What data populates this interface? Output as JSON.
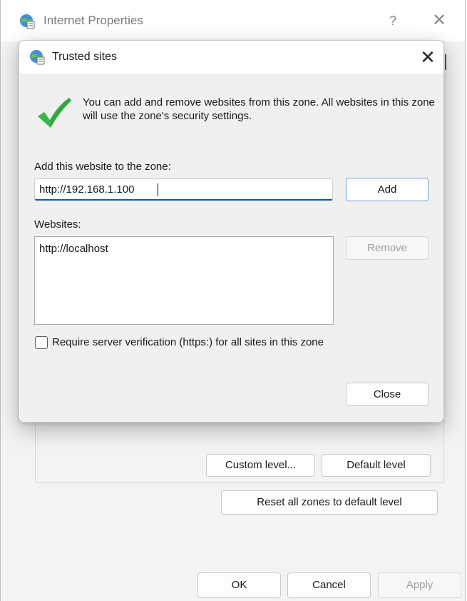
{
  "parent": {
    "title": "Internet Properties",
    "help_label": "?",
    "close_label": "✕",
    "custom_level_label": "Custom level...",
    "default_level_label": "Default level",
    "reset_all_label": "Reset all zones to default level",
    "ok_label": "OK",
    "cancel_label": "Cancel",
    "apply_label": "Apply"
  },
  "dialog": {
    "title": "Trusted sites",
    "close_label": "✕",
    "description": "You can add and remove websites from this zone. All websites in this zone will use the zone's security settings.",
    "add_website_label": "Add this website to the zone:",
    "website_input_value": "http://192.168.1.100",
    "add_button_label": "Add",
    "websites_label": "Websites:",
    "websites": [
      "http://localhost"
    ],
    "remove_button_label": "Remove",
    "require_verification_label": "Require server verification (https:) for all sites in this zone",
    "require_verification_checked": false,
    "close_button_label": "Close"
  },
  "icons": {
    "window_icon": "globe-shield-icon",
    "info_icon": "green-checkmark-icon"
  },
  "colors": {
    "accent": "#005fb8",
    "check_green": "#3cb64a",
    "disabled_text": "#9d9d9d"
  }
}
